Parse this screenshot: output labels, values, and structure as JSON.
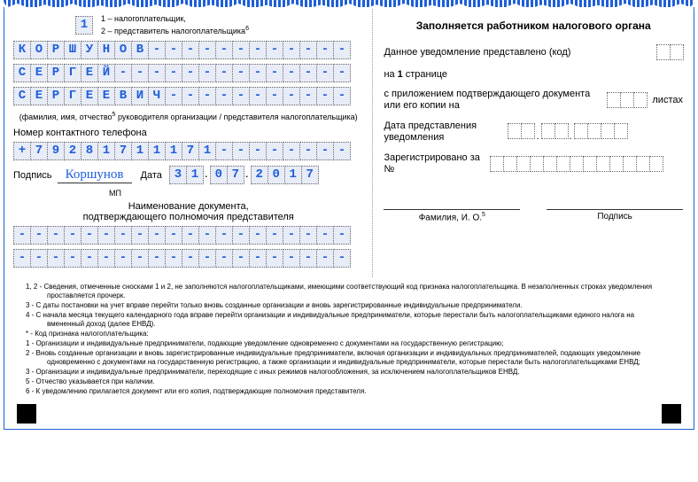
{
  "taxpayer_type": {
    "value": "1",
    "option1": "1 – налогоплательщик,",
    "option2": "2 – представитель налогоплательщика"
  },
  "name": {
    "line1": "КОРШУНОВ",
    "line2": "СЕРГЕЙ",
    "line3": "СЕРГЕЕВИЧ",
    "caption": "(фамилия, имя, отчество",
    "caption2": " руководителя организации / представителя налогоплательщика)"
  },
  "phone": {
    "label": "Номер контактного телефона",
    "value": "+79281711171"
  },
  "sign": {
    "label": "Подпись",
    "value": "Коршунов",
    "mp": "МП",
    "date_label": "Дата",
    "date": [
      "3",
      "1",
      "",
      "0",
      "7",
      "",
      "2",
      "0",
      "1",
      "7"
    ]
  },
  "doc": {
    "line1": "Наименование документа,",
    "line2": "подтверждающего полномочия представителя"
  },
  "right": {
    "title": "Заполняется работником налогового органа",
    "r1": "Данное уведомление представлено (код)",
    "r2_1": "на ",
    "r2_2": "1",
    "r2_3": " странице",
    "r3": "с приложением подтверждающего документа или его копии на",
    "r3_unit": "листах",
    "r4": "Дата представления уведомления",
    "r5": "Зарегистрировано за №",
    "fio": "Фамилия, И. О.",
    "sig": "Подпись"
  },
  "footnotes": [
    "1, 2 - Сведения, отмеченные сносками 1 и 2, не заполняются  налогоплательщиками, имеющими соответствующий код признака налогоплательщика. В незаполненных строках уведомления проставляется прочерк.",
    "3 - С даты постановки на учет вправе перейти только вновь созданные организации и вновь зарегистрированные индивидуальные предприниматели.",
    "4 - С начала месяца текущего календарного года вправе перейти организации и индивидуальные предприниматели, которые перестали быть налогоплательщиками  единого налога на вмененный  доход (далее ЕНВД).",
    "* - Код признака налогоплательщика:",
    "     1 - Организации и индивидуальные предприниматели, подающие уведомление одновременно с документами на государственную регистрацию;",
    "     2 - Вновь созданные организации и вновь зарегистрированные индивидуальные предприниматели, включая организации и индивидуальных предпринимателей, подающих уведомление одновременно с документами на государственную регистрацию, а также организации и индивидуальные предприниматели, которые перестали быть налогоплательщиками ЕНВД;",
    "     3 - Организации и индивидуальные предприниматели, переходящие с иных режимов налогообложения, за исключением налогоплательщиков ЕНВД.",
    "5 - Отчество указывается при наличии.",
    "6 - К уведомлению прилагается документ или его копия, подтверждающие  полномочия представителя."
  ]
}
